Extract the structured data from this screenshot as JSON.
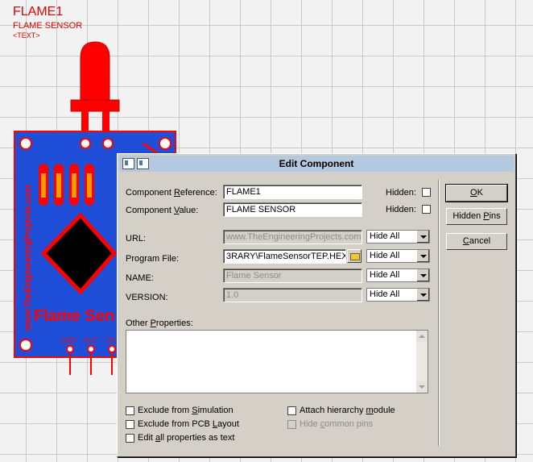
{
  "canvas": {
    "ref": "FLAME1",
    "value": "FLAME SENSOR",
    "text_placeholder": "<TEXT>",
    "board_text_vertical": "www.TheEngineeringProjects.com",
    "board_text": "Flame Sen",
    "pin_labels": [
      "GND",
      "OUT",
      "VC"
    ]
  },
  "dialog": {
    "title": "Edit Component",
    "component_reference_label": "Component Reference:",
    "component_reference_value": "FLAME1",
    "component_value_label": "Component Value:",
    "component_value_value": "FLAME SENSOR",
    "hidden_label": "Hidden:",
    "url_label": "URL:",
    "url_value": "www.TheEngineeringProjects.com",
    "program_file_label": "Program File:",
    "program_file_value": "3RARY\\FlameSensorTEP.HEX",
    "name_label": "NAME:",
    "name_value": "Flame Sensor",
    "version_label": "VERSION:",
    "version_value": "1.0",
    "hide_option": "Hide All",
    "other_properties_label": "Other Properties:",
    "checkboxes": {
      "exclude_sim": "Exclude from Simulation",
      "exclude_pcb": "Exclude from PCB Layout",
      "edit_all": "Edit all properties as text",
      "attach_hier": "Attach hierarchy module",
      "hide_pins": "Hide common pins"
    },
    "buttons": {
      "ok": "OK",
      "hidden_pins": "Hidden Pins",
      "cancel": "Cancel"
    }
  },
  "colors": {
    "board": "#1f4fd8",
    "part_red": "#e00000",
    "board_border": "#e00000"
  }
}
